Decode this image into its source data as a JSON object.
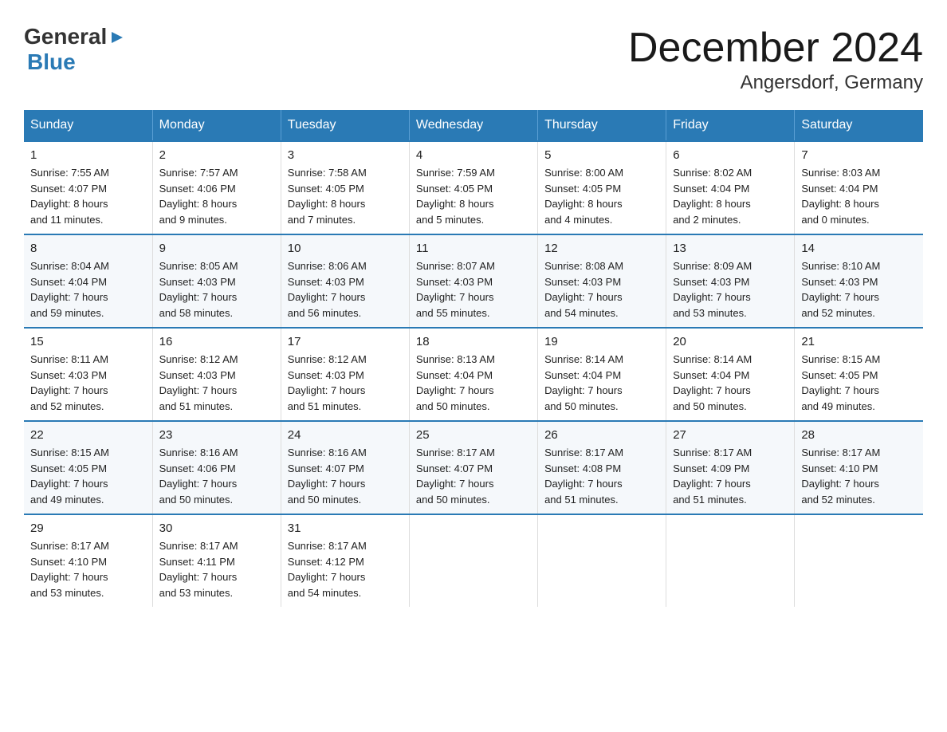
{
  "logo": {
    "line1": "General",
    "arrow": "▶",
    "line2": "Blue"
  },
  "title": "December 2024",
  "subtitle": "Angersdorf, Germany",
  "days": [
    "Sunday",
    "Monday",
    "Tuesday",
    "Wednesday",
    "Thursday",
    "Friday",
    "Saturday"
  ],
  "weeks": [
    [
      {
        "num": "1",
        "info": "Sunrise: 7:55 AM\nSunset: 4:07 PM\nDaylight: 8 hours\nand 11 minutes."
      },
      {
        "num": "2",
        "info": "Sunrise: 7:57 AM\nSunset: 4:06 PM\nDaylight: 8 hours\nand 9 minutes."
      },
      {
        "num": "3",
        "info": "Sunrise: 7:58 AM\nSunset: 4:05 PM\nDaylight: 8 hours\nand 7 minutes."
      },
      {
        "num": "4",
        "info": "Sunrise: 7:59 AM\nSunset: 4:05 PM\nDaylight: 8 hours\nand 5 minutes."
      },
      {
        "num": "5",
        "info": "Sunrise: 8:00 AM\nSunset: 4:05 PM\nDaylight: 8 hours\nand 4 minutes."
      },
      {
        "num": "6",
        "info": "Sunrise: 8:02 AM\nSunset: 4:04 PM\nDaylight: 8 hours\nand 2 minutes."
      },
      {
        "num": "7",
        "info": "Sunrise: 8:03 AM\nSunset: 4:04 PM\nDaylight: 8 hours\nand 0 minutes."
      }
    ],
    [
      {
        "num": "8",
        "info": "Sunrise: 8:04 AM\nSunset: 4:04 PM\nDaylight: 7 hours\nand 59 minutes."
      },
      {
        "num": "9",
        "info": "Sunrise: 8:05 AM\nSunset: 4:03 PM\nDaylight: 7 hours\nand 58 minutes."
      },
      {
        "num": "10",
        "info": "Sunrise: 8:06 AM\nSunset: 4:03 PM\nDaylight: 7 hours\nand 56 minutes."
      },
      {
        "num": "11",
        "info": "Sunrise: 8:07 AM\nSunset: 4:03 PM\nDaylight: 7 hours\nand 55 minutes."
      },
      {
        "num": "12",
        "info": "Sunrise: 8:08 AM\nSunset: 4:03 PM\nDaylight: 7 hours\nand 54 minutes."
      },
      {
        "num": "13",
        "info": "Sunrise: 8:09 AM\nSunset: 4:03 PM\nDaylight: 7 hours\nand 53 minutes."
      },
      {
        "num": "14",
        "info": "Sunrise: 8:10 AM\nSunset: 4:03 PM\nDaylight: 7 hours\nand 52 minutes."
      }
    ],
    [
      {
        "num": "15",
        "info": "Sunrise: 8:11 AM\nSunset: 4:03 PM\nDaylight: 7 hours\nand 52 minutes."
      },
      {
        "num": "16",
        "info": "Sunrise: 8:12 AM\nSunset: 4:03 PM\nDaylight: 7 hours\nand 51 minutes."
      },
      {
        "num": "17",
        "info": "Sunrise: 8:12 AM\nSunset: 4:03 PM\nDaylight: 7 hours\nand 51 minutes."
      },
      {
        "num": "18",
        "info": "Sunrise: 8:13 AM\nSunset: 4:04 PM\nDaylight: 7 hours\nand 50 minutes."
      },
      {
        "num": "19",
        "info": "Sunrise: 8:14 AM\nSunset: 4:04 PM\nDaylight: 7 hours\nand 50 minutes."
      },
      {
        "num": "20",
        "info": "Sunrise: 8:14 AM\nSunset: 4:04 PM\nDaylight: 7 hours\nand 50 minutes."
      },
      {
        "num": "21",
        "info": "Sunrise: 8:15 AM\nSunset: 4:05 PM\nDaylight: 7 hours\nand 49 minutes."
      }
    ],
    [
      {
        "num": "22",
        "info": "Sunrise: 8:15 AM\nSunset: 4:05 PM\nDaylight: 7 hours\nand 49 minutes."
      },
      {
        "num": "23",
        "info": "Sunrise: 8:16 AM\nSunset: 4:06 PM\nDaylight: 7 hours\nand 50 minutes."
      },
      {
        "num": "24",
        "info": "Sunrise: 8:16 AM\nSunset: 4:07 PM\nDaylight: 7 hours\nand 50 minutes."
      },
      {
        "num": "25",
        "info": "Sunrise: 8:17 AM\nSunset: 4:07 PM\nDaylight: 7 hours\nand 50 minutes."
      },
      {
        "num": "26",
        "info": "Sunrise: 8:17 AM\nSunset: 4:08 PM\nDaylight: 7 hours\nand 51 minutes."
      },
      {
        "num": "27",
        "info": "Sunrise: 8:17 AM\nSunset: 4:09 PM\nDaylight: 7 hours\nand 51 minutes."
      },
      {
        "num": "28",
        "info": "Sunrise: 8:17 AM\nSunset: 4:10 PM\nDaylight: 7 hours\nand 52 minutes."
      }
    ],
    [
      {
        "num": "29",
        "info": "Sunrise: 8:17 AM\nSunset: 4:10 PM\nDaylight: 7 hours\nand 53 minutes."
      },
      {
        "num": "30",
        "info": "Sunrise: 8:17 AM\nSunset: 4:11 PM\nDaylight: 7 hours\nand 53 minutes."
      },
      {
        "num": "31",
        "info": "Sunrise: 8:17 AM\nSunset: 4:12 PM\nDaylight: 7 hours\nand 54 minutes."
      },
      {
        "num": "",
        "info": ""
      },
      {
        "num": "",
        "info": ""
      },
      {
        "num": "",
        "info": ""
      },
      {
        "num": "",
        "info": ""
      }
    ]
  ]
}
